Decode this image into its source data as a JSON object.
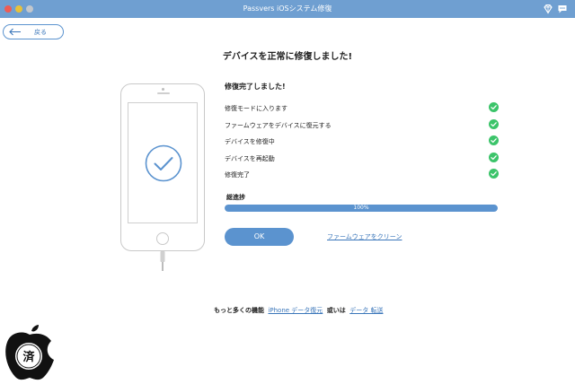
{
  "window": {
    "title": "Passvers iOSシステム修復"
  },
  "nav": {
    "back_label": "戻る"
  },
  "headline": "デバイスを正常に修復しました!",
  "status": {
    "title": "修復完了しました!",
    "steps": [
      {
        "label": "修復モードに入ります",
        "status": "done"
      },
      {
        "label": "ファームウェアをデバイスに復元する",
        "status": "done"
      },
      {
        "label": "デバイスを修復中",
        "status": "done"
      },
      {
        "label": "デバイスを再起動",
        "status": "done"
      },
      {
        "label": "修復完了",
        "status": "done"
      }
    ]
  },
  "progress": {
    "label": "総進捗",
    "percent": 100,
    "text": "100%"
  },
  "actions": {
    "ok_label": "OK",
    "clean_firmware_label": "ファームウェアをクリーン"
  },
  "footer": {
    "prefix": "もっと多くの機能",
    "link1": "iPhone データ復元",
    "middle": "或いは",
    "link2": "データ 転送"
  },
  "colors": {
    "titlebar": "#6f9fd1",
    "accent": "#5b93cf",
    "link": "#3a76ba",
    "success": "#3cc46a"
  },
  "icons": {
    "back": "arrow-left-icon",
    "step_done": "check-circle-icon",
    "phone_check": "check-circle-outline-icon",
    "titlebar_left": "diamond-icon",
    "titlebar_right": "chat-bubble-icon"
  },
  "watermark": {
    "text": "済"
  }
}
